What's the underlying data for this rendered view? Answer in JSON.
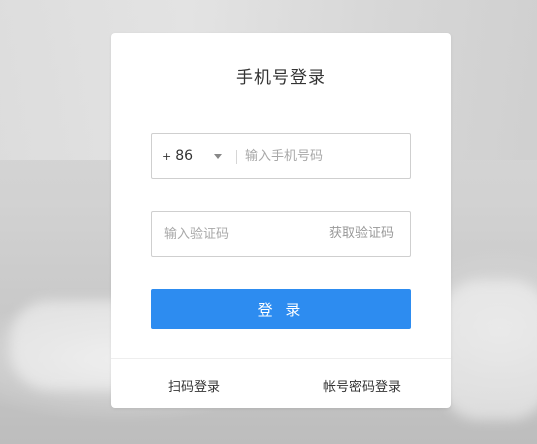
{
  "login": {
    "title": "手机号登录",
    "phone": {
      "country_plus": "+",
      "country_code": "86",
      "placeholder": "输入手机号码",
      "value": ""
    },
    "code": {
      "placeholder": "输入验证码",
      "value": "",
      "get_code_label": "获取验证码"
    },
    "submit_label": "登 录",
    "footer": {
      "scan_label": "扫码登录",
      "password_label": "帐号密码登录"
    },
    "colors": {
      "primary": "#2d8cf0",
      "card": "#ffffff",
      "border": "#cfcfcf"
    },
    "icons": {
      "country_dropdown": "caret-down-icon"
    }
  }
}
